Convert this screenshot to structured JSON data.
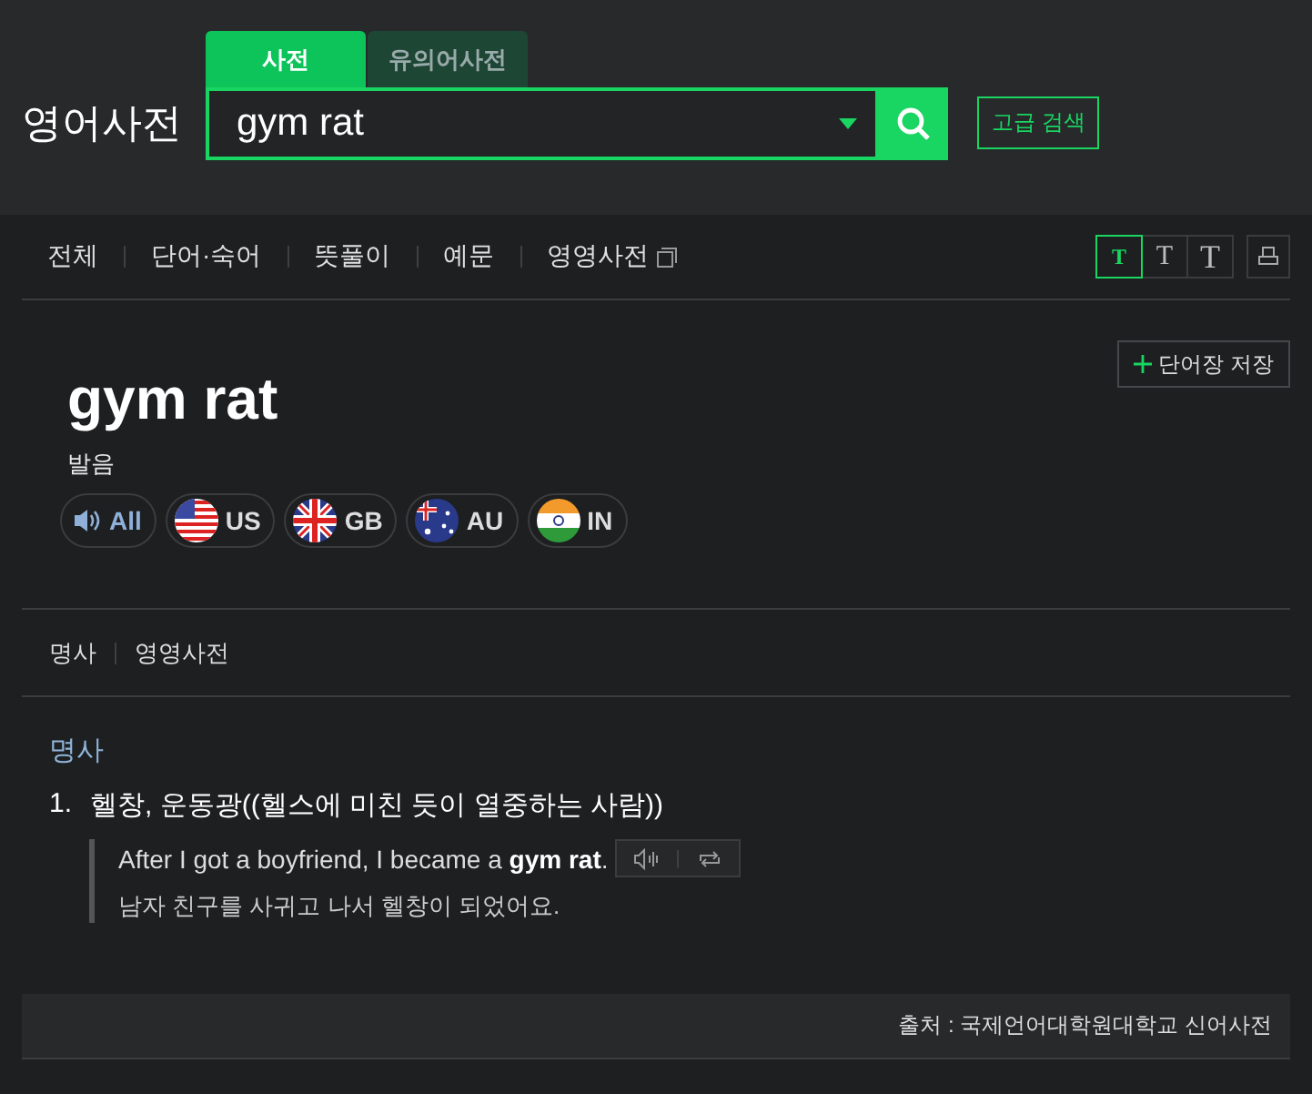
{
  "header": {
    "logo": "영어사전",
    "search_tabs": [
      {
        "label": "사전",
        "selected": true
      },
      {
        "label": "유의어사전",
        "selected": false
      }
    ],
    "search": {
      "value": "gym rat"
    },
    "advanced_button": "고급 검색"
  },
  "nav": {
    "items": [
      {
        "label": "전체",
        "external": false
      },
      {
        "label": "단어·숙어",
        "external": false
      },
      {
        "label": "뜻풀이",
        "external": false
      },
      {
        "label": "예문",
        "external": false
      },
      {
        "label": "영영사전",
        "external": true
      }
    ],
    "font_sizes": [
      {
        "label": "T",
        "selected": true
      },
      {
        "label": "T",
        "selected": false
      },
      {
        "label": "T",
        "selected": false
      }
    ]
  },
  "entry": {
    "word": "gym rat",
    "save_button": "단어장 저장",
    "pron_label": "발음",
    "pronunciations": [
      {
        "kind": "all",
        "label": "All"
      },
      {
        "kind": "us",
        "label": "US"
      },
      {
        "kind": "gb",
        "label": "GB"
      },
      {
        "kind": "au",
        "label": "AU"
      },
      {
        "kind": "in",
        "label": "IN"
      }
    ]
  },
  "sections": [
    "명사",
    "영영사전"
  ],
  "meanings": {
    "pos": "명사",
    "items": [
      {
        "number": "1.",
        "text": "헬창, 운동광((헬스에 미친 듯이 열중하는 사람))",
        "example": "After I got a boyfriend, I became a **gym rat**.",
        "translation": "남자 친구를 사귀고 나서 헬창이 되었어요."
      }
    ]
  },
  "source": "출처 : 국제언어대학원대학교 신어사전"
}
